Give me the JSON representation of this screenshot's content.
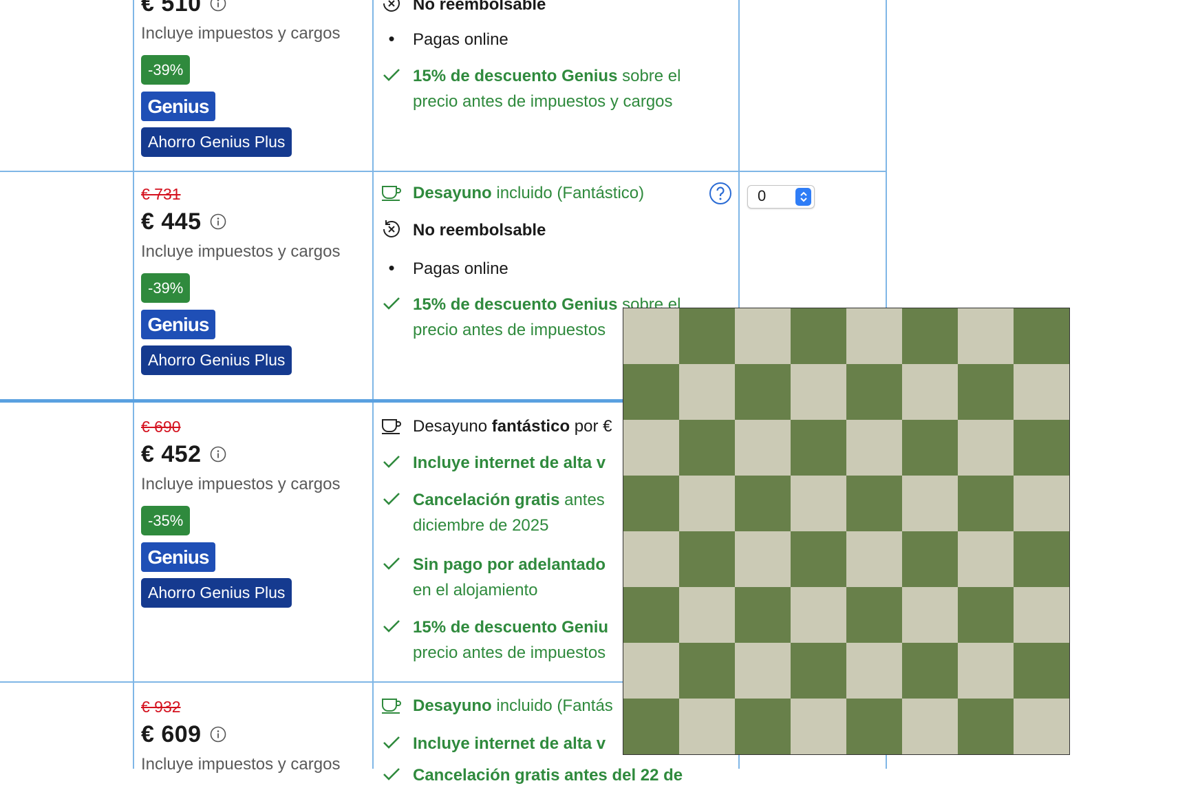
{
  "colors": {
    "accent_green": "#2f8a3d",
    "strike_red": "#d4111e",
    "border_blue": "#7fb6e6",
    "genius_blue": "#1f4fb6",
    "genius_plus_navy": "#153a8f",
    "board_light": "#cbcab5",
    "board_dark": "#68804a"
  },
  "rows": [
    {
      "price": "€ 510",
      "taxes": "Incluye impuestos y cargos",
      "discount": "-39%",
      "genius": "Genius",
      "plus": "Ahorro Genius Plus",
      "conditions": {
        "refund": "No reembolsable",
        "pay": "Pagas online",
        "genius_bold": "15% de descuento Genius",
        "genius_rest_1": " sobre el",
        "genius_rest_2": "precio antes de impuestos y cargos"
      }
    },
    {
      "old_price": "€ 731",
      "price": "€ 445",
      "taxes": "Incluye impuestos y cargos",
      "discount": "-39%",
      "genius": "Genius",
      "plus": "Ahorro Genius Plus",
      "conditions": {
        "breakfast_bold": "Desayuno",
        "breakfast_rest": " incluido (Fantástico)",
        "refund": "No reembolsable",
        "pay": "Pagas online",
        "genius_bold": "15% de descuento Genius",
        "genius_rest_1": " sobre el",
        "genius_rest_2": "precio antes de impuestos"
      },
      "quantity": "0"
    },
    {
      "old_price": "€ 690",
      "price": "€ 452",
      "taxes": "Incluye impuestos y cargos",
      "discount": "-35%",
      "genius": "Genius",
      "plus": "Ahorro Genius Plus",
      "conditions": {
        "breakfast_pre": "Desayuno ",
        "breakfast_bold": "fantástico",
        "breakfast_rest": " por €",
        "internet": "Incluye internet de alta v",
        "cancel_bold": "Cancelación gratis",
        "cancel_rest": " antes",
        "cancel_line2": "diciembre de 2025",
        "nopay_bold": "Sin pago por adelantado",
        "nopay_line2": "en el alojamiento",
        "genius_bold": "15% de descuento Geniu",
        "genius_rest_2": "precio antes de impuestos"
      }
    },
    {
      "old_price": "€ 932",
      "price": "€ 609",
      "taxes": "Incluye impuestos y cargos",
      "conditions": {
        "breakfast_bold": "Desayuno",
        "breakfast_rest": " incluido (Fantás",
        "internet": "Incluye internet de alta v",
        "cancel_partial": "Cancelación gratis antes del 22 de"
      }
    }
  ]
}
